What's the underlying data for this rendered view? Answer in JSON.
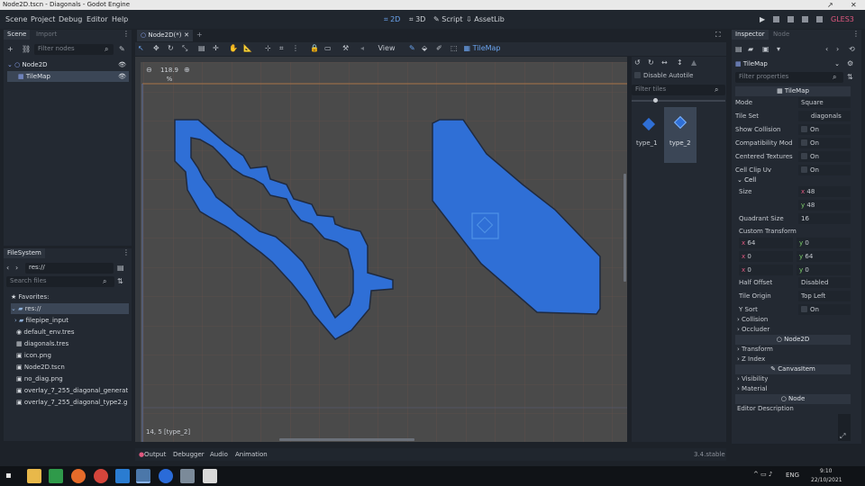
{
  "window": {
    "title": "Node2D.tscn - Diagonals - Godot Engine"
  },
  "menu": [
    "Scene",
    "Project",
    "Debug",
    "Editor",
    "Help"
  ],
  "workspaces": [
    {
      "label": "2D",
      "icon": "2d-icon"
    },
    {
      "label": "3D",
      "icon": "3d-icon"
    },
    {
      "label": "Script",
      "icon": "script-icon"
    },
    {
      "label": "AssetLib",
      "icon": "assetlib-icon"
    }
  ],
  "renderer": "GLES3",
  "scene_dock": {
    "tabs": [
      "Scene",
      "Import"
    ],
    "filter_placeholder": "Filter nodes",
    "nodes": [
      {
        "name": "Node2D",
        "selected": false
      },
      {
        "name": "TileMap",
        "selected": true
      }
    ]
  },
  "filesystem": {
    "tab": "FileSystem",
    "path": "res://",
    "search_placeholder": "Search files",
    "items": [
      {
        "label": "Favorites:",
        "type": "favorites"
      },
      {
        "label": "res://",
        "type": "folder",
        "selected": true
      },
      {
        "label": "filepipe_input",
        "type": "folder"
      },
      {
        "label": "default_env.tres",
        "type": "file"
      },
      {
        "label": "diagonals.tres",
        "type": "file"
      },
      {
        "label": "icon.png",
        "type": "file"
      },
      {
        "label": "Node2D.tscn",
        "type": "file"
      },
      {
        "label": "no_diag.png",
        "type": "file"
      },
      {
        "label": "overlay_7_255_diagonal_generat",
        "type": "file"
      },
      {
        "label": "overlay_7_255_diagonal_type2.g",
        "type": "file"
      }
    ]
  },
  "editor_tab": "Node2D(*)",
  "toolbar": {
    "view_label": "View",
    "tilemap_label": "TileMap"
  },
  "viewport": {
    "zoom": "118.9 %",
    "status": "14, 5 [type_2]",
    "tile_color": "#2f6fd6",
    "selection_color": "#4f93e6"
  },
  "tile_palette": {
    "options": [
      "Disable Autotile"
    ],
    "filter_placeholder": "Filter tiles",
    "tiles": [
      {
        "label": "type_1",
        "selected": false
      },
      {
        "label": "type_2",
        "selected": true
      }
    ]
  },
  "bottom_panel": {
    "tabs": [
      "Output",
      "Debugger",
      "Audio",
      "Animation"
    ],
    "version": "3.4.stable"
  },
  "inspector": {
    "tabs": [
      "Inspector",
      "Node"
    ],
    "node": "TileMap",
    "filter_placeholder": "Filter properties",
    "class_title": "TileMap",
    "props": [
      {
        "label": "Mode",
        "value": "Square"
      },
      {
        "label": "Tile Set",
        "value": "diagonals"
      },
      {
        "label": "Show Collision",
        "value": "On"
      },
      {
        "label": "Compatibility Mod",
        "value": "On"
      },
      {
        "label": "Centered Textures",
        "value": "On"
      },
      {
        "label": "Cell Clip Uv",
        "value": "On"
      }
    ],
    "cell_section": "Cell",
    "cell": {
      "size_label": "Size",
      "size_x": "48",
      "size_y": "48",
      "quadrant_label": "Quadrant Size",
      "quadrant": "16",
      "custom_label": "Custom Transform",
      "transform": [
        [
          "64",
          "0"
        ],
        [
          "0",
          "64"
        ],
        [
          "0",
          "0"
        ]
      ],
      "half_offset_label": "Half Offset",
      "half_offset": "Disabled",
      "tile_origin_label": "Tile Origin",
      "tile_origin": "Top Left",
      "ysort_label": "Y Sort",
      "ysort": "On"
    },
    "collapsed": [
      "Collision",
      "Occluder"
    ],
    "node2d_title": "Node2D",
    "node2d_items": [
      "Transform",
      "Z Index"
    ],
    "canvas_title": "CanvasItem",
    "canvas_items": [
      "Visibility",
      "Material"
    ],
    "node_title": "Node",
    "editor_description": "Editor Description"
  },
  "taskbar": {
    "lang": "ENG",
    "time": "9:10",
    "date": "22/10/2021"
  }
}
